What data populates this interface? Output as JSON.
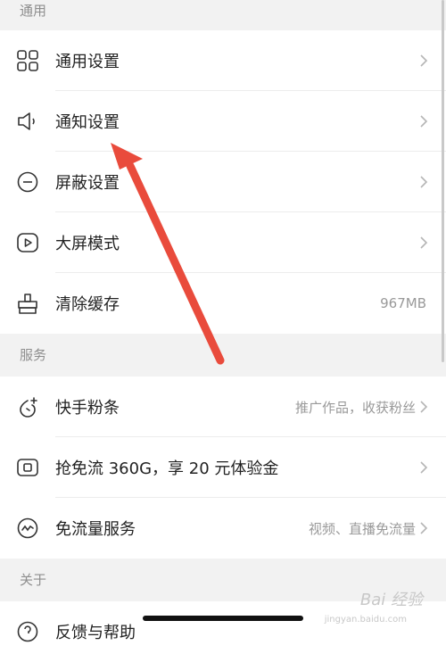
{
  "sections": {
    "general": {
      "header": "通用"
    },
    "services": {
      "header": "服务"
    },
    "about": {
      "header": "关于"
    }
  },
  "general_items": [
    {
      "label": "通用设置",
      "icon": "grid-icon"
    },
    {
      "label": "通知设置",
      "icon": "speaker-icon"
    },
    {
      "label": "屏蔽设置",
      "icon": "block-icon"
    },
    {
      "label": "大屏模式",
      "icon": "play-screen-icon"
    },
    {
      "label": "清除缓存",
      "icon": "broom-icon",
      "value": "967MB"
    }
  ],
  "service_items": [
    {
      "label": "快手粉条",
      "icon": "fans-icon",
      "value": "推广作品，收获粉丝"
    },
    {
      "label": "抢免流 360G，享 20 元体验金",
      "icon": "data-card-icon"
    },
    {
      "label": "免流量服务",
      "icon": "wave-icon",
      "value": "视频、直播免流量"
    }
  ],
  "about_items": [
    {
      "label": "反馈与帮助",
      "icon": "help-icon"
    }
  ],
  "watermark": {
    "text": "Bai 经验",
    "sub": "jingyan.baidu.com"
  },
  "colors": {
    "arrow": "#e94b3c",
    "background": "#f2f2f2",
    "row": "#ffffff"
  }
}
